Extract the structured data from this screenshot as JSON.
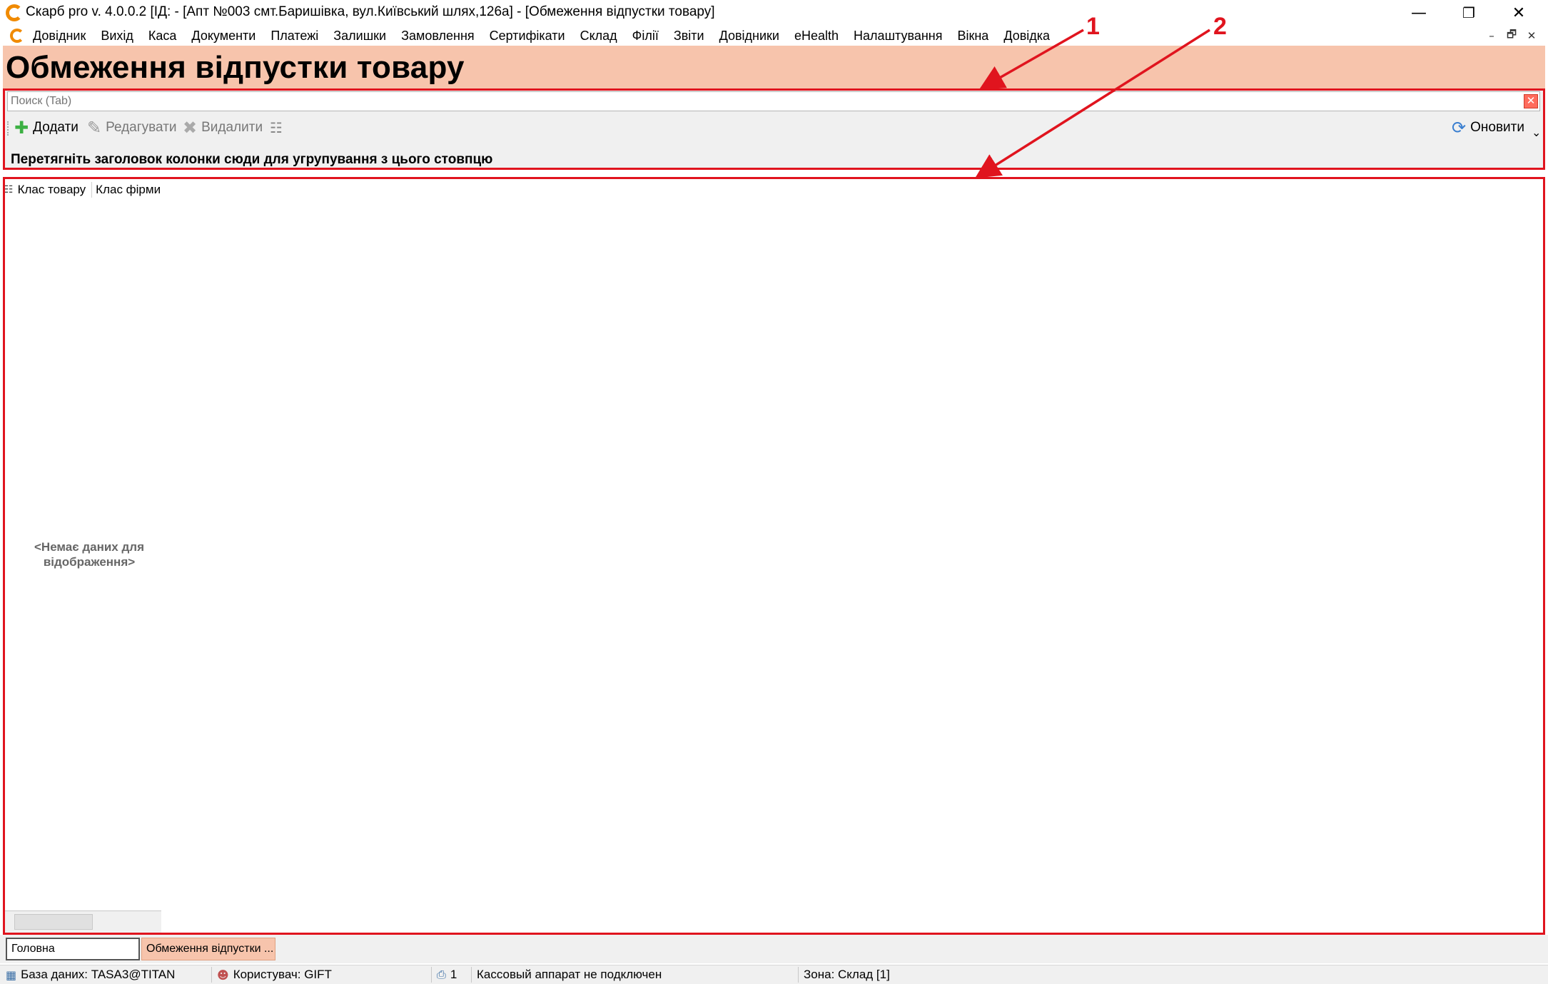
{
  "window": {
    "title": "Скарб pro v. 4.0.0.2 [ІД:          - [Апт №003 смт.Баришівка, вул.Київський шлях,126а] - [Обмеження відпустки товару]",
    "minimize_glyph": "—",
    "restore_glyph": "❐",
    "close_glyph": "✕"
  },
  "menu": {
    "items": [
      "Довідник",
      "Вихід",
      "Каса",
      "Документи",
      "Платежі",
      "Залишки",
      "Замовлення",
      "Сертифікати",
      "Склад",
      "Філії",
      "Звіти",
      "Довідники",
      "eHealth",
      "Налаштування",
      "Вікна",
      "Довідка"
    ],
    "mdi_minimize": "–",
    "mdi_restore": "🗗",
    "mdi_close": "✕"
  },
  "page": {
    "title": "Обмеження відпустки товару"
  },
  "search": {
    "placeholder": "Поиск (Tab)",
    "value": "",
    "clear_icon": "✕"
  },
  "toolbar": {
    "add_label": "Додати",
    "add_icon": "✚",
    "edit_label": "Редагувати",
    "edit_icon": "✎",
    "delete_label": "Видалити",
    "delete_icon": "✖",
    "columns_icon": "☷",
    "refresh_label": "Оновити",
    "refresh_icon": "⟳",
    "overflow_icon": "⌄"
  },
  "grid": {
    "group_hint": "Перетягніть заголовок колонки сюди для угрупування з цього стовпцю",
    "columns": [
      "Клас товару",
      "Клас фірми"
    ],
    "column_chooser_icon": "☷",
    "rows": [],
    "empty_text_line1": "<Немає даних для",
    "empty_text_line2": "відображення>"
  },
  "tabs": [
    {
      "label": "Головна",
      "active": false
    },
    {
      "label": "Обмеження відпустки ...",
      "active": true
    }
  ],
  "status": {
    "database": "База даних: TASA3@TITAN",
    "user": "Користувач: GIFT",
    "cash_count": "1",
    "cash_status": "Кассовый аппарат не подключен",
    "zone": "Зона: Склад [1]"
  },
  "annotations": {
    "label_1": "1",
    "label_2": "2",
    "color": "#e0141e"
  },
  "colors": {
    "header_bg": "#f7c4ac",
    "active_tab_bg": "#f7c4ac",
    "accent_orange": "#f08a00"
  }
}
